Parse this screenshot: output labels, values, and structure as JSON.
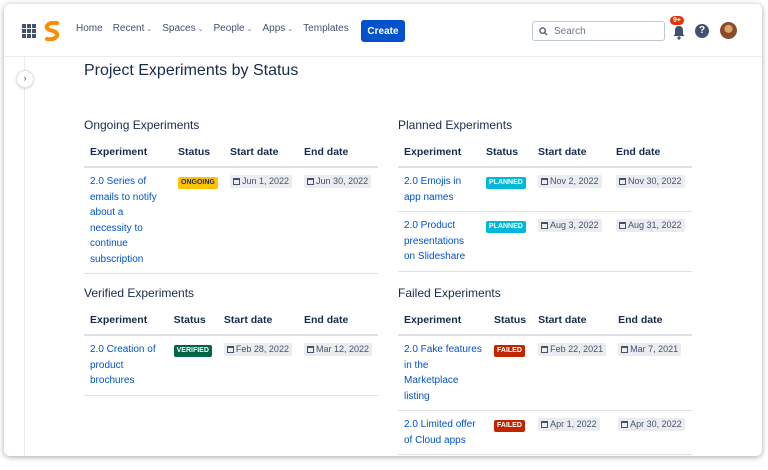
{
  "nav": {
    "home": "Home",
    "recent": "Recent",
    "spaces": "Spaces",
    "people": "People",
    "apps": "Apps",
    "templates": "Templates",
    "create": "Create",
    "search_placeholder": "Search",
    "notifications_badge": "9+",
    "help": "?"
  },
  "colors": {
    "accent": "#0052cc",
    "ongoing": "#ffc400",
    "planned": "#00b8d9",
    "verified": "#006644",
    "failed": "#bf2600"
  },
  "page": {
    "title": "Project Experiments by Status"
  },
  "ongoing": {
    "title": "Ongoing Experiments",
    "headers": [
      "Experiment",
      "Status",
      "Start date",
      "End date"
    ],
    "rows": [
      {
        "experiment": "2.0 Series of emails to notify about a necessity to continue subscription",
        "status": "ONGOING",
        "start": "Jun 1, 2022",
        "end": "Jun 30, 2022"
      }
    ]
  },
  "planned": {
    "title": "Planned Experiments",
    "headers": [
      "Experiment",
      "Status",
      "Start date",
      "End date"
    ],
    "rows": [
      {
        "experiment": "2.0 Emojis in app names",
        "status": "PLANNED",
        "start": "Nov 2, 2022",
        "end": "Nov 30, 2022"
      },
      {
        "experiment": "2.0 Product presentations on Slideshare",
        "status": "PLANNED",
        "start": "Aug 3, 2022",
        "end": "Aug 31, 2022"
      }
    ]
  },
  "verified": {
    "title": "Verified Experiments",
    "headers": [
      "Experiment",
      "Status",
      "Start date",
      "End date"
    ],
    "rows": [
      {
        "experiment": "2.0 Creation of product brochures",
        "status": "VERIFIED",
        "start": "Feb 28, 2022",
        "end": "Mar 12, 2022"
      }
    ]
  },
  "failed": {
    "title": "Failed Experiments",
    "headers": [
      "Experiment",
      "Status",
      "Start date",
      "End date"
    ],
    "rows": [
      {
        "experiment": "2.0 Fake features in the Marketplace listing",
        "status": "FAILED",
        "start": "Feb 22, 2021",
        "end": "Mar 7, 2021"
      },
      {
        "experiment": "2.0 Limited offer of Cloud apps",
        "status": "FAILED",
        "start": "Apr 1, 2022",
        "end": "Apr 30, 2022"
      }
    ]
  }
}
